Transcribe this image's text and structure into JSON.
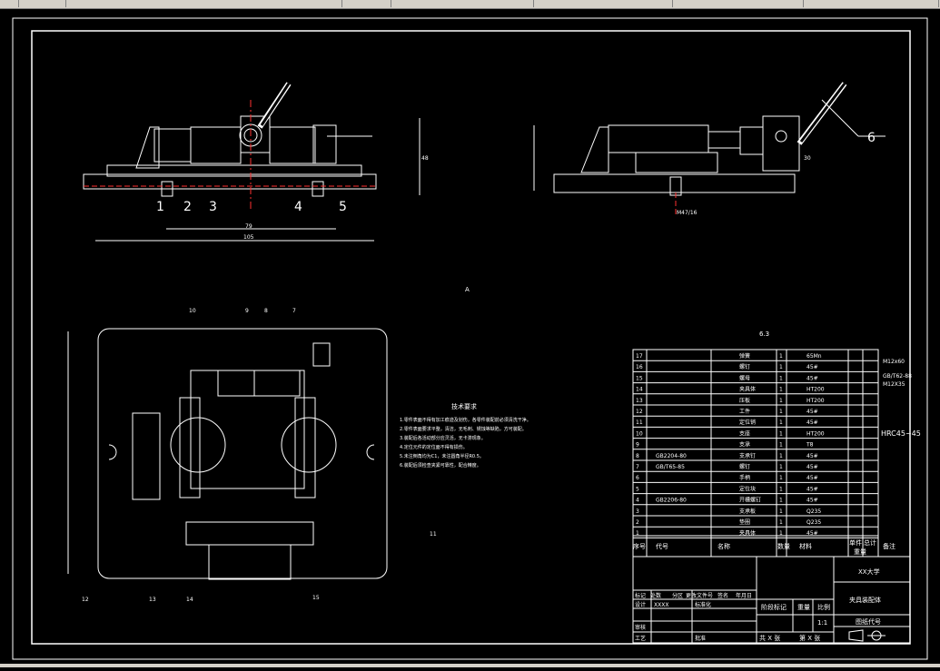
{
  "toolbar": {
    "items": [
      "",
      "",
      "",
      "",
      "",
      "",
      ""
    ]
  },
  "drawing": {
    "labels_top": [
      "1",
      "2",
      "3",
      "4",
      "5",
      "6"
    ],
    "labels_plan": [
      "10",
      "9",
      "8",
      "7",
      "11",
      "12",
      "13",
      "14",
      "15"
    ],
    "dims_front": [
      "79",
      "105",
      "48"
    ],
    "dims_side": [
      "M47/16",
      "30"
    ],
    "center_mark": "A",
    "roughness": "6.3",
    "hardness": "HRC45~45",
    "tech_title": "技术要求",
    "tech_lines": [
      "1.零件表面不得有加工痕迹及划伤，各零件装配前必须清洗干净。",
      "2.零件表面要求平整，清洁，无毛刺、锈蚀等缺陷，方可装配。",
      "3.装配后各活动部分应灵活，无卡滞现象。",
      "4.定位元件的定位面不得有损伤。",
      "5.未注倒角均为C1，未注圆角半径R0.5。",
      "6.装配后须检查夹紧可靠性，配合精度。"
    ],
    "side_notes": [
      "M12x60",
      "GB/T62-88",
      "M12X35"
    ]
  },
  "bom": {
    "rows": [
      {
        "no": "17",
        "code": "",
        "name": "弹簧",
        "qty": "1",
        "mat": "65Mn"
      },
      {
        "no": "16",
        "code": "",
        "name": "螺钉",
        "qty": "1",
        "mat": "45#"
      },
      {
        "no": "15",
        "code": "",
        "name": "螺母",
        "qty": "1",
        "mat": "45#"
      },
      {
        "no": "14",
        "code": "",
        "name": "夹具体",
        "qty": "1",
        "mat": "HT200"
      },
      {
        "no": "13",
        "code": "",
        "name": "压板",
        "qty": "1",
        "mat": "HT200"
      },
      {
        "no": "12",
        "code": "",
        "name": "工件",
        "qty": "1",
        "mat": "45#"
      },
      {
        "no": "11",
        "code": "",
        "name": "定位销",
        "qty": "1",
        "mat": "45#"
      },
      {
        "no": "10",
        "code": "",
        "name": "支座",
        "qty": "1",
        "mat": "HT200"
      },
      {
        "no": "9",
        "code": "",
        "name": "支承",
        "qty": "1",
        "mat": "T8"
      },
      {
        "no": "8",
        "code": "GB2204-80",
        "name": "支承钉",
        "qty": "1",
        "mat": "45#"
      },
      {
        "no": "7",
        "code": "GB/T65-85",
        "name": "螺钉",
        "qty": "1",
        "mat": "45#"
      },
      {
        "no": "6",
        "code": "",
        "name": "手柄",
        "qty": "1",
        "mat": "45#"
      },
      {
        "no": "5",
        "code": "",
        "name": "定位块",
        "qty": "1",
        "mat": "45#"
      },
      {
        "no": "4",
        "code": "GB2206-80",
        "name": "开槽螺钉",
        "qty": "1",
        "mat": "45#"
      },
      {
        "no": "3",
        "code": "",
        "name": "支承板",
        "qty": "1",
        "mat": "Q235"
      },
      {
        "no": "2",
        "code": "",
        "name": "垫圈",
        "qty": "1",
        "mat": "Q235"
      },
      {
        "no": "1",
        "code": "",
        "name": "夹具体",
        "qty": "1",
        "mat": "45#"
      }
    ],
    "header": {
      "no": "序号",
      "code": "代号",
      "name": "名称",
      "qty": "数量",
      "mat": "材料",
      "w1": "单件",
      "w2": "总计",
      "wt": "重量",
      "note": "备注"
    }
  },
  "titleblock": {
    "school": "XX大学",
    "title": "夹具装配体",
    "scale_label": "比例",
    "scale": "1:1",
    "drawing_no": "图纸代号",
    "stage": "阶段标记",
    "weight": "重量",
    "sheets_total": "共 X 张",
    "sheet_no": "第 X 张",
    "rows": [
      "标记",
      "处数",
      "分区",
      "更改文件号",
      "签名",
      "年月日"
    ],
    "design": "设计",
    "design_name": "XXXX",
    "std": "标准化",
    "check": "审核",
    "process": "工艺",
    "approve": "批准"
  },
  "colors": {
    "line": "#ffffff",
    "red": "#ff3030",
    "yellow": "#ffff00",
    "magenta": "#ff40ff",
    "green": "#40ff40"
  }
}
